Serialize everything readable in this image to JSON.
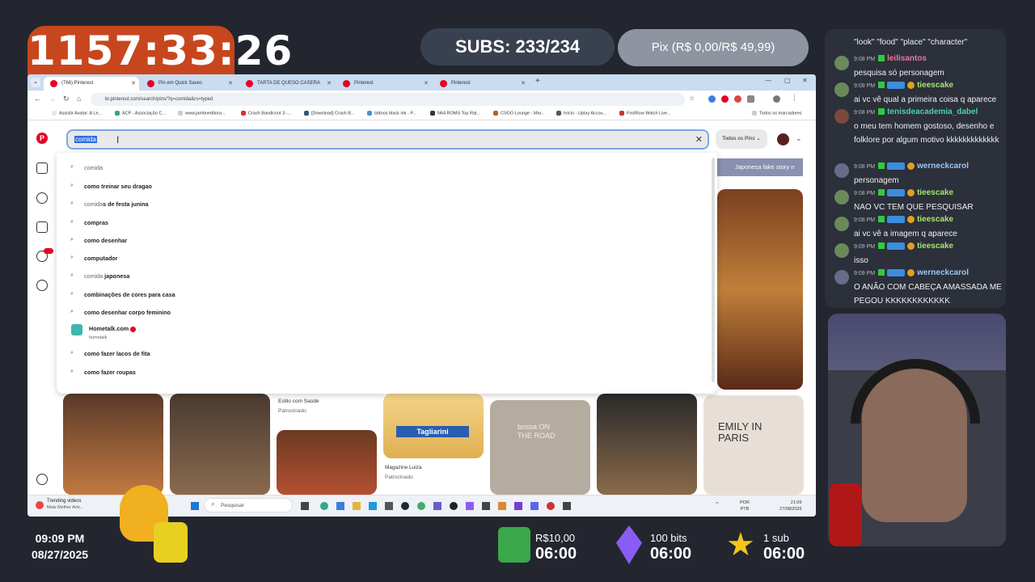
{
  "overlay": {
    "timer": "1157:33:26",
    "subs": "SUBS: 233/234",
    "pix": "Pix (R$ 0,00/R$ 49,99)",
    "clock_time": "09:09 PM",
    "clock_date": "08/27/2025",
    "goals": [
      {
        "title": "R$10,00",
        "value": "06:00",
        "icon": "money-icon"
      },
      {
        "title": "100 bits",
        "value": "06:00",
        "icon": "bits-gem-icon"
      },
      {
        "title": "1 sub",
        "value": "06:00",
        "icon": "star-icon"
      }
    ]
  },
  "browser": {
    "tabs": [
      {
        "label": "(766) Pinterest"
      },
      {
        "label": "Pin em Quick Saves"
      },
      {
        "label": "TARTA DE QUESO CASERA"
      },
      {
        "label": "Pinterest"
      },
      {
        "label": "Pinterest"
      }
    ],
    "new_tab": "+",
    "url": "br.pinterest.com/search/pins/?q=comida&rs=typed",
    "bookmarks": [
      "Assistir Avatar: A Le...",
      "ACP - Associação C...",
      "www.jamboeditora...",
      "Crash Bandicoot 3 -...",
      "[Download] Crash B...",
      "tattoos black ink - P...",
      "N64 ROMS Top Rat...",
      "CSGO Lounge - Mar...",
      "Início - Uplay Accou...",
      "FirstRow Watch Live..."
    ],
    "bookmarks_all": "Todos os marcadores"
  },
  "pinterest": {
    "search_value": "comida",
    "filter_label": "Todos os Pins",
    "suggestions": [
      {
        "prefix": "comida",
        "rest": ""
      },
      {
        "prefix": "",
        "rest": "como treinar seu dragao"
      },
      {
        "prefix": "comida",
        "rest": "s de festa junina"
      },
      {
        "prefix": "",
        "rest": "compras"
      },
      {
        "prefix": "",
        "rest": "como desenhar"
      },
      {
        "prefix": "",
        "rest": "computador"
      },
      {
        "prefix": "comida",
        "rest": " japonesa"
      },
      {
        "prefix": "",
        "rest": "combinações de cores para casa"
      },
      {
        "prefix": "",
        "rest": "como desenhar corpo feminino"
      },
      {
        "prefix": "",
        "rest": "como fazer lacos de fita"
      },
      {
        "prefix": "",
        "rest": "como fazer roupas"
      }
    ],
    "account_suggestion": {
      "name": "Hometalk.com",
      "handle": "hometalk"
    },
    "side_pin_title": "Japonesa fake story n",
    "pins": [
      {
        "title": "Estilo com Saúde",
        "sub": "Patrocinado"
      },
      {
        "title": "Tagliarini",
        "sub": ""
      },
      {
        "title": "Magazine Luiza",
        "sub": "Patrocinado"
      },
      {
        "title": "bossa ON THE ROAD",
        "sub": ""
      },
      {
        "title": "EMILY IN PARIS",
        "sub": ""
      }
    ]
  },
  "taskbar": {
    "trending_title": "Trending videos",
    "trending_sub": "Mais Melhor Ami...",
    "search_placeholder": "Pesquisar",
    "lang": "POR",
    "lang2": "PTB",
    "time": "21:09",
    "date": "27/08/2025"
  },
  "chat": [
    {
      "time": "",
      "user": "",
      "text": "\"look\" \"food\" \"place\" \"character\"",
      "color": ""
    },
    {
      "time": "9:08 PM",
      "user": "leilisantos",
      "text": "pesquisa só personagem",
      "color": "#e9789a"
    },
    {
      "time": "9:08 PM",
      "user": "tieescake",
      "text": "ai vc vê qual a primeira coisa q aparece",
      "color": "#a7e36f"
    },
    {
      "time": "9:08 PM",
      "user": "tenisdeacademia_dabel",
      "text": "o meu tem homem gostoso, desenho e folklore por algum motivo kkkkkkkkkkkkk",
      "color": "#4fd1a5"
    },
    {
      "time": "9:08 PM",
      "user": "werneckcarol",
      "text": "personagem",
      "color": "#9ec6f5"
    },
    {
      "time": "9:08 PM",
      "user": "tieescake",
      "text": "NAO VC TEM QUE PESQUISAR",
      "color": "#a7e36f"
    },
    {
      "time": "9:08 PM",
      "user": "tieescake",
      "text": "ai vc vê a imagem q aparece",
      "color": "#a7e36f"
    },
    {
      "time": "9:09 PM",
      "user": "tieescake",
      "text": "isso",
      "color": "#a7e36f"
    },
    {
      "time": "9:09 PM",
      "user": "werneckcarol",
      "text": "O ANÃO COM CABEÇA AMASSADA ME PEGOU KKKKKKKKKKKK",
      "color": "#9ec6f5"
    }
  ]
}
